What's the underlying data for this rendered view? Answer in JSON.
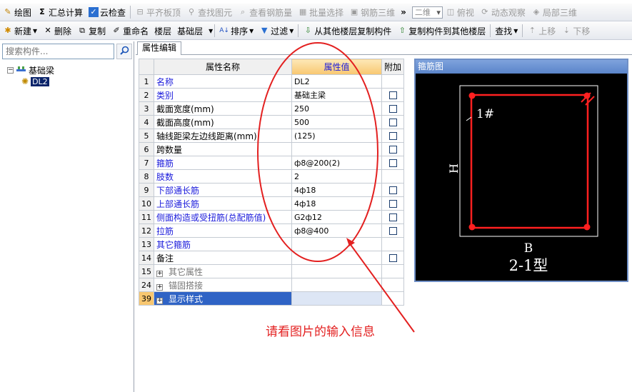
{
  "toolbar1": {
    "draw": "绘图",
    "summary_calc": "汇总计算",
    "cloud_check": "云检查",
    "flat_slab_top": "平齐板顶",
    "find_element": "查找图元",
    "view_rebar": "查看钢筋量",
    "batch_select": "批量选择",
    "rebar_3d": "钢筋三维",
    "more": "»",
    "view_mode": "二维",
    "top_view": "俯视",
    "dynamic_view": "动态观察",
    "local_3d": "局部三维"
  },
  "toolbar2": {
    "new": "新建",
    "delete": "删除",
    "copy": "复制",
    "rename": "重命名",
    "floor_label": "楼层",
    "floor_value": "基础层",
    "sort": "排序",
    "filter": "过滤",
    "copy_from_floor": "从其他楼层复制构件",
    "copy_to_floor": "复制构件到其他楼层",
    "find": "查找",
    "move_up": "上移",
    "move_down": "下移"
  },
  "search": {
    "placeholder": "搜索构件..."
  },
  "tree": {
    "root": "基础梁",
    "child": "DL2"
  },
  "tab": {
    "label": "属性编辑"
  },
  "table": {
    "headers": {
      "name": "属性名称",
      "value": "属性值",
      "extra": "附加"
    },
    "rows": [
      {
        "num": "1",
        "name": "名称",
        "value": "DL2"
      },
      {
        "num": "2",
        "name": "类别",
        "value": "基础主梁"
      },
      {
        "num": "3",
        "name": "截面宽度(mm)",
        "value": "250"
      },
      {
        "num": "4",
        "name": "截面高度(mm)",
        "value": "500"
      },
      {
        "num": "5",
        "name": "轴线距梁左边线距离(mm)",
        "value": "(125)"
      },
      {
        "num": "6",
        "name": "跨数量",
        "value": ""
      },
      {
        "num": "7",
        "name": "箍筋",
        "value": "ф8@200(2)"
      },
      {
        "num": "8",
        "name": "肢数",
        "value": "2"
      },
      {
        "num": "9",
        "name": "下部通长筋",
        "value": "4ф18"
      },
      {
        "num": "10",
        "name": "上部通长筋",
        "value": "4ф18"
      },
      {
        "num": "11",
        "name": "侧面构造或受扭筋(总配筋值)",
        "value": "G2ф12"
      },
      {
        "num": "12",
        "name": "拉筋",
        "value": "ф8@400"
      },
      {
        "num": "13",
        "name": "其它箍筋",
        "value": ""
      },
      {
        "num": "14",
        "name": "备注",
        "value": ""
      },
      {
        "num": "15",
        "name": "其它属性",
        "value": ""
      },
      {
        "num": "24",
        "name": "锚固搭接",
        "value": ""
      },
      {
        "num": "39",
        "name": "显示样式",
        "value": ""
      }
    ]
  },
  "stirrup": {
    "title": "箍筋图",
    "label_1": "1#",
    "label_h": "H",
    "label_b": "B",
    "type_label": "2-1型"
  },
  "annotation": {
    "text": "请看图片的输入信息"
  },
  "colors": {
    "highlight": "#f8c770",
    "annotation": "#e32020",
    "blue_text": "#1a1adb",
    "rebar": "#ff2020"
  }
}
